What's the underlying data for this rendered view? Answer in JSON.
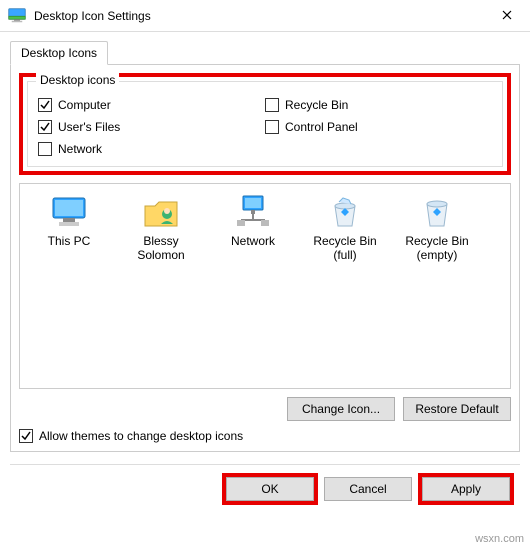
{
  "title": "Desktop Icon Settings",
  "tab": "Desktop Icons",
  "group_legend": "Desktop icons",
  "checks": {
    "computer": {
      "label": "Computer",
      "checked": true
    },
    "recyclebin": {
      "label": "Recycle Bin",
      "checked": false
    },
    "usersfiles": {
      "label": "User's Files",
      "checked": true
    },
    "controlpanel": {
      "label": "Control Panel",
      "checked": false
    },
    "network": {
      "label": "Network",
      "checked": false
    }
  },
  "previews": [
    {
      "label": "This PC"
    },
    {
      "label": "Blessy Solomon"
    },
    {
      "label": "Network"
    },
    {
      "label": "Recycle Bin (full)"
    },
    {
      "label": "Recycle Bin (empty)"
    }
  ],
  "buttons": {
    "change_icon": "Change Icon...",
    "restore_default": "Restore Default",
    "ok": "OK",
    "cancel": "Cancel",
    "apply": "Apply"
  },
  "allow_themes": {
    "label": "Allow themes to change desktop icons",
    "checked": true
  },
  "watermark": "wsxn.com"
}
